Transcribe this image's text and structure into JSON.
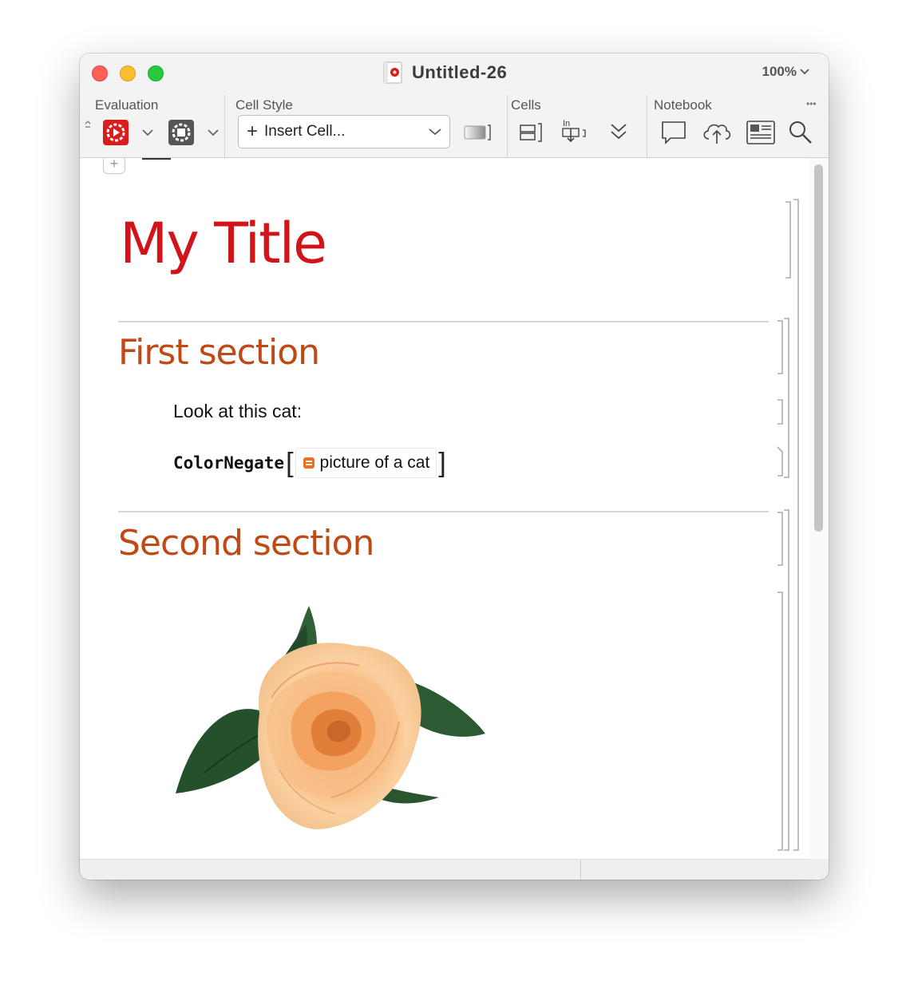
{
  "window": {
    "title": "Untitled-26",
    "zoom": "100%"
  },
  "toolbar": {
    "groups": {
      "evaluation": "Evaluation",
      "cell_style": "Cell Style",
      "cells": "Cells",
      "notebook": "Notebook"
    },
    "insert_cell_label": "Insert Cell...",
    "more_glyph": "•••",
    "icons": {
      "evaluate": "evaluate-gear-icon",
      "abort": "abort-gear-icon",
      "cell_group": "cell-group-icon",
      "cell_merge": "cell-merge-icon",
      "cell_input": "cell-input-icon",
      "expand": "double-chevron-down-icon",
      "comment": "comment-icon",
      "cloud": "cloud-upload-icon",
      "present": "presenter-icon",
      "search": "search-icon"
    },
    "colors": {
      "evaluate_red": "#dc1b1b",
      "muted_gray": "#555555"
    }
  },
  "notebook": {
    "title": "My Title",
    "sections": [
      {
        "heading": "First section",
        "text": "Look at this cat:",
        "input": {
          "function": "ColorNegate",
          "natural_language": "picture of a cat"
        }
      },
      {
        "heading": "Second section",
        "output": "rose-image"
      }
    ],
    "colors": {
      "title": "#d0141a",
      "section": "#c04a16"
    }
  }
}
